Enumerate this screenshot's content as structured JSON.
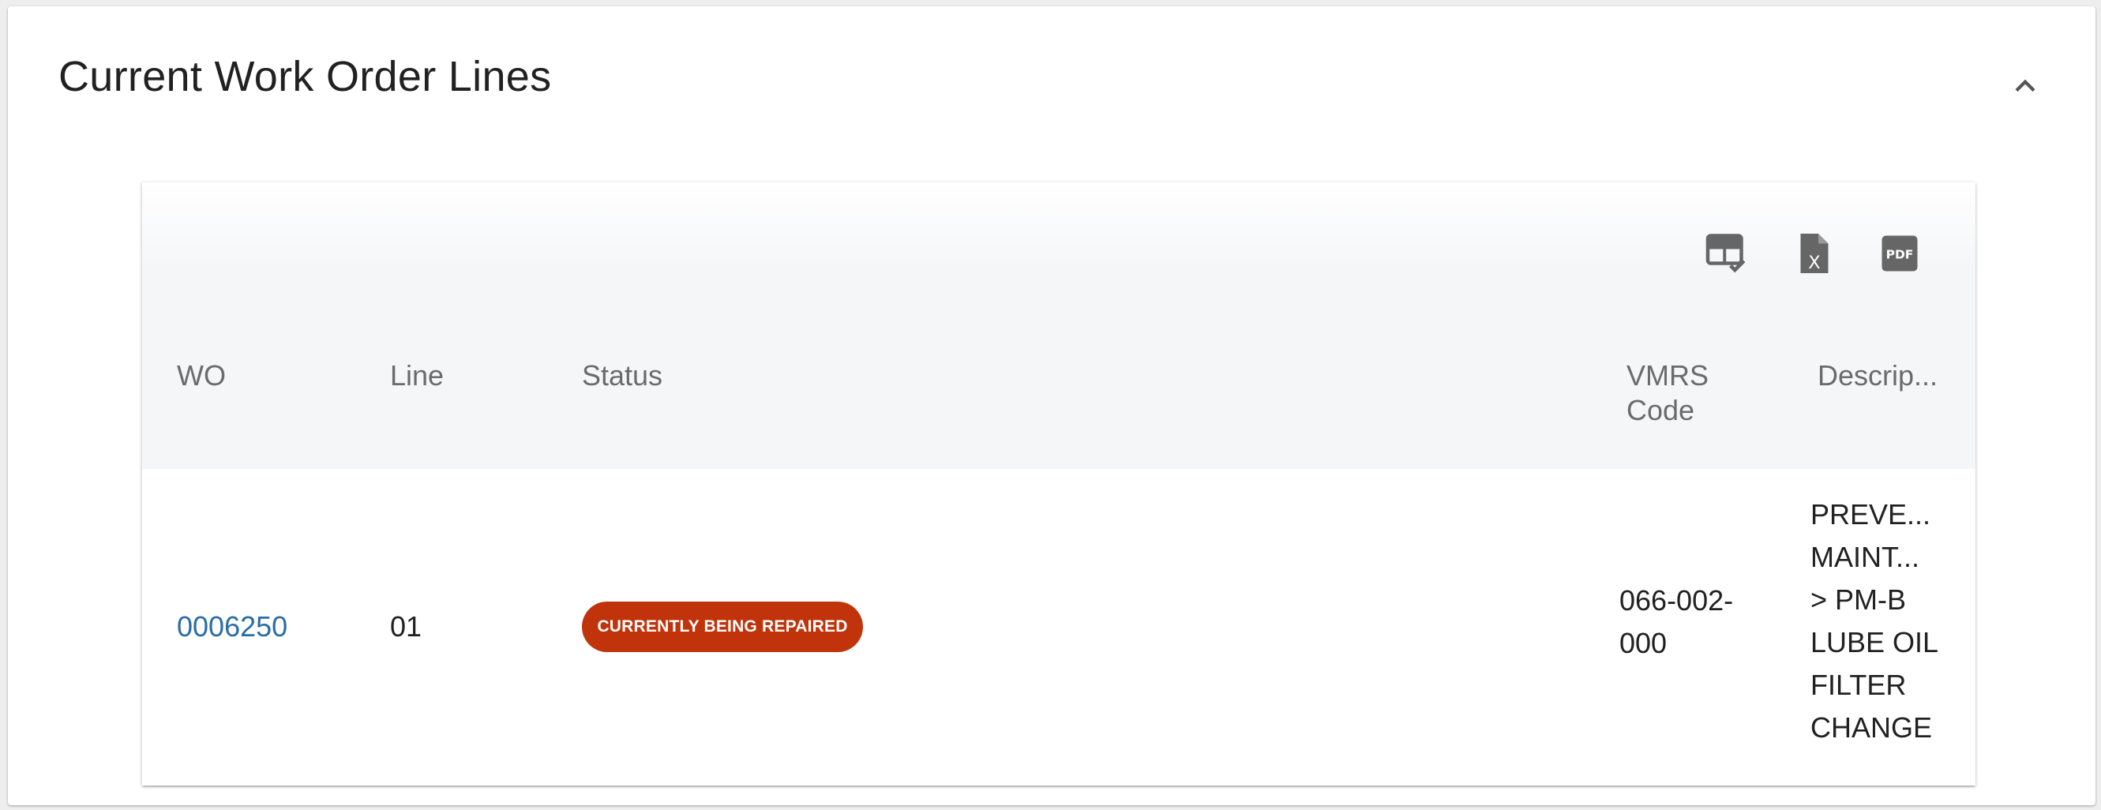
{
  "panel": {
    "title": "Current Work Order Lines",
    "collapse_icon": "chevron-up-icon"
  },
  "toolbar": {
    "icons": [
      "table-check-icon",
      "excel-file-icon",
      "pdf-file-icon"
    ],
    "excel_glyph": "X",
    "pdf_glyph": "PDF"
  },
  "table": {
    "columns": {
      "wo": "WO",
      "line": "Line",
      "status": "Status",
      "vmrs_line1": "VMRS",
      "vmrs_line2": "Code",
      "description": "Descrip..."
    },
    "rows": [
      {
        "wo": "0006250",
        "line": "01",
        "status": "CURRENTLY BEING REPAIRED",
        "vmrs_line1": "066-002-",
        "vmrs_line2": "000",
        "description_lines": [
          "PREVE...",
          "MAINT...",
          "> PM-B",
          "LUBE OIL",
          "FILTER",
          "CHANGE"
        ]
      }
    ]
  },
  "colors": {
    "link": "#2a6ca7",
    "status_chip": "#c1340b",
    "header_bg": "#f5f6f8"
  }
}
